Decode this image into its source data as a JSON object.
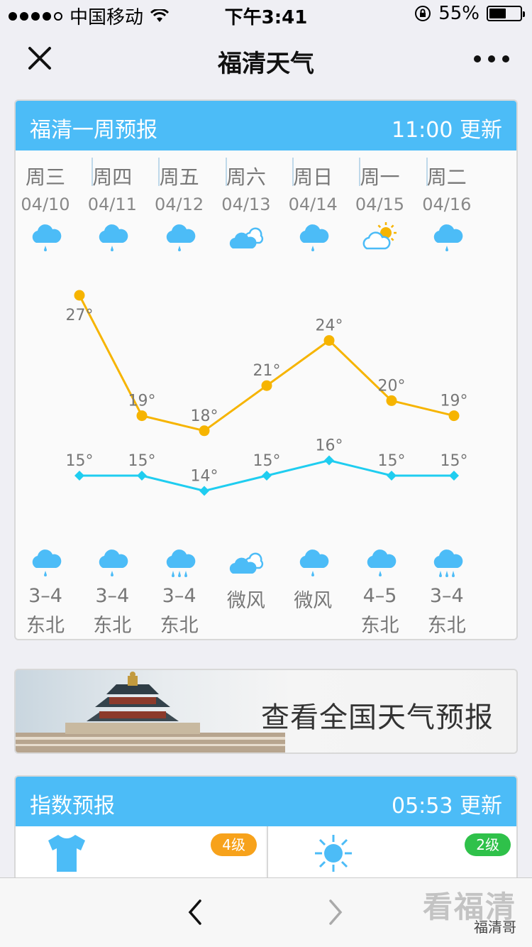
{
  "status_bar": {
    "carrier": "中国移动",
    "time": "下午3:41",
    "battery": "55%",
    "battery_level": 0.55
  },
  "nav": {
    "title": "福清天气"
  },
  "forecast": {
    "title": "福清一周预报",
    "updated": "11:00 更新",
    "days": [
      {
        "day": "周三",
        "date": "04/10",
        "icon": "rain-icon",
        "high": "27°",
        "low": "15°",
        "wind_level": "3–4",
        "wind_dir": "东北",
        "night_icon": "rain-icon"
      },
      {
        "day": "周四",
        "date": "04/11",
        "icon": "rain-icon",
        "high": "19°",
        "low": "15°",
        "wind_level": "3–4",
        "wind_dir": "东北",
        "night_icon": "rain-icon"
      },
      {
        "day": "周五",
        "date": "04/12",
        "icon": "rain-icon",
        "high": "18°",
        "low": "14°",
        "wind_level": "3–4",
        "wind_dir": "东北",
        "night_icon": "heavy-rain-icon"
      },
      {
        "day": "周六",
        "date": "04/13",
        "icon": "cloudy-icon",
        "high": "21°",
        "low": "15°",
        "wind_level": "微风",
        "wind_dir": "",
        "night_icon": "cloudy-icon"
      },
      {
        "day": "周日",
        "date": "04/14",
        "icon": "rain-icon",
        "high": "24°",
        "low": "16°",
        "wind_level": "微风",
        "wind_dir": "",
        "night_icon": "rain-icon"
      },
      {
        "day": "周一",
        "date": "04/15",
        "icon": "partly-sunny-icon",
        "high": "20°",
        "low": "15°",
        "wind_level": "4–5",
        "wind_dir": "东北",
        "night_icon": "rain-icon"
      },
      {
        "day": "周二",
        "date": "04/16",
        "icon": "rain-icon",
        "high": "19°",
        "low": "15°",
        "wind_level": "3–4",
        "wind_dir": "东北",
        "night_icon": "heavy-rain-icon"
      }
    ]
  },
  "chart_data": {
    "type": "line",
    "categories": [
      "04/10",
      "04/11",
      "04/12",
      "04/13",
      "04/14",
      "04/15",
      "04/16"
    ],
    "series": [
      {
        "values": [
          27,
          19,
          18,
          21,
          24,
          20,
          19
        ],
        "color": "#f6b400"
      },
      {
        "values": [
          15,
          15,
          14,
          15,
          16,
          15,
          15
        ],
        "color": "#1fcdf0"
      }
    ]
  },
  "banner": {
    "text": "查看全国天气预报"
  },
  "index": {
    "title": "指数预报",
    "updated": "05:53 更新",
    "items": [
      {
        "icon": "shirt-icon",
        "badge": "4级",
        "badge_color": "#f7a21b"
      },
      {
        "icon": "uv-icon",
        "badge": "2级",
        "badge_color": "#2fc14a"
      }
    ]
  },
  "watermark": {
    "main": "看福清",
    "sub": "福清哥"
  },
  "colors": {
    "accent": "#4cbcf7",
    "high_line": "#f6b400",
    "low_line": "#1fcdf0"
  }
}
